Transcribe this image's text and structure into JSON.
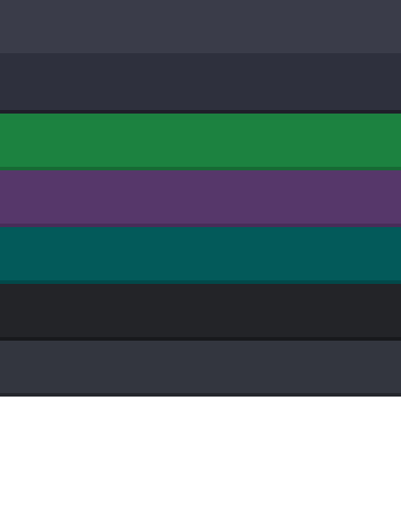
{
  "swatches": [
    {
      "fill": "#3a3c49",
      "edge": "#3a3c49"
    },
    {
      "fill": "#2e303d",
      "edge": "#1f2029"
    },
    {
      "fill": "#1c8240",
      "edge": "#176a34"
    },
    {
      "fill": "#56376a",
      "edge": "#482d59"
    },
    {
      "fill": "#035a5a",
      "edge": "#02494a"
    },
    {
      "fill": "#232428",
      "edge": "#18191c"
    },
    {
      "fill": "#33363f",
      "edge": "#25272d"
    }
  ]
}
